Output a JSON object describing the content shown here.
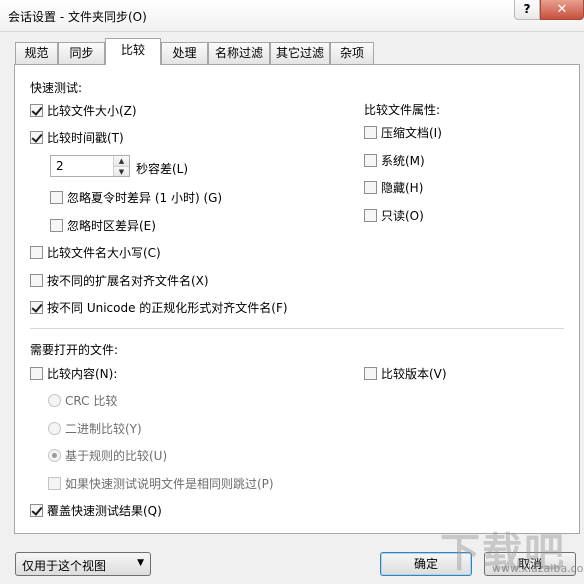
{
  "window": {
    "title": "会话设置 - 文件夹同步(O)",
    "help_label": "?",
    "close_label": "✕"
  },
  "tabs": [
    {
      "label": "规范"
    },
    {
      "label": "同步"
    },
    {
      "label": "比较"
    },
    {
      "label": "处理"
    },
    {
      "label": "名称过滤"
    },
    {
      "label": "其它过滤"
    },
    {
      "label": "杂项"
    }
  ],
  "quick_test": {
    "heading": "快速测试:",
    "compare_size": {
      "label": "比较文件大小(Z)",
      "checked": true
    },
    "compare_timestamp": {
      "label": "比较时间戳(T)",
      "checked": true
    },
    "tolerance_value": "2",
    "tolerance_label": "秒容差(L)",
    "ignore_dst": {
      "label": "忽略夏令时差异 (1 小时) (G)",
      "checked": false
    },
    "ignore_tz": {
      "label": "忽略时区差异(E)",
      "checked": false
    },
    "compare_name_case": {
      "label": "比较文件名大小写(C)",
      "checked": false
    },
    "align_ext": {
      "label": "按不同的扩展名对齐文件名(X)",
      "checked": false
    },
    "align_unicode": {
      "label": "按不同 Unicode 的正规化形式对齐文件名(F)",
      "checked": true
    }
  },
  "attributes": {
    "heading": "比较文件属性:",
    "items": [
      {
        "label": "压缩文档(I)",
        "checked": false
      },
      {
        "label": "系统(M)",
        "checked": false
      },
      {
        "label": "隐藏(H)",
        "checked": false
      },
      {
        "label": "只读(O)",
        "checked": false
      }
    ]
  },
  "open_files": {
    "heading": "需要打开的文件:",
    "compare_content": {
      "label": "比较内容(N):",
      "checked": false
    },
    "compare_version": {
      "label": "比较版本(V)",
      "checked": false
    },
    "crc": {
      "label": "CRC 比较"
    },
    "binary": {
      "label": "二进制比较(Y)"
    },
    "rules": {
      "label": "基于规则的比较(U)",
      "selected": true
    },
    "skip_if_same": {
      "label": "如果快速测试说明文件是相同则跳过(P)",
      "checked": false
    },
    "override_quick": {
      "label": "覆盖快速测试结果(Q)",
      "checked": true
    }
  },
  "footer": {
    "scope_value": "仅用于这个视图",
    "ok_label": "确定",
    "cancel_label": "取消"
  },
  "watermark": {
    "text": "下载吧",
    "subtext": "www.xiazaiba.com"
  },
  "icons": {
    "checkmark": "checkmark-icon",
    "spin_up": "spin-up-icon",
    "spin_down": "spin-down-icon",
    "dropdown": "chevron-down-icon"
  }
}
